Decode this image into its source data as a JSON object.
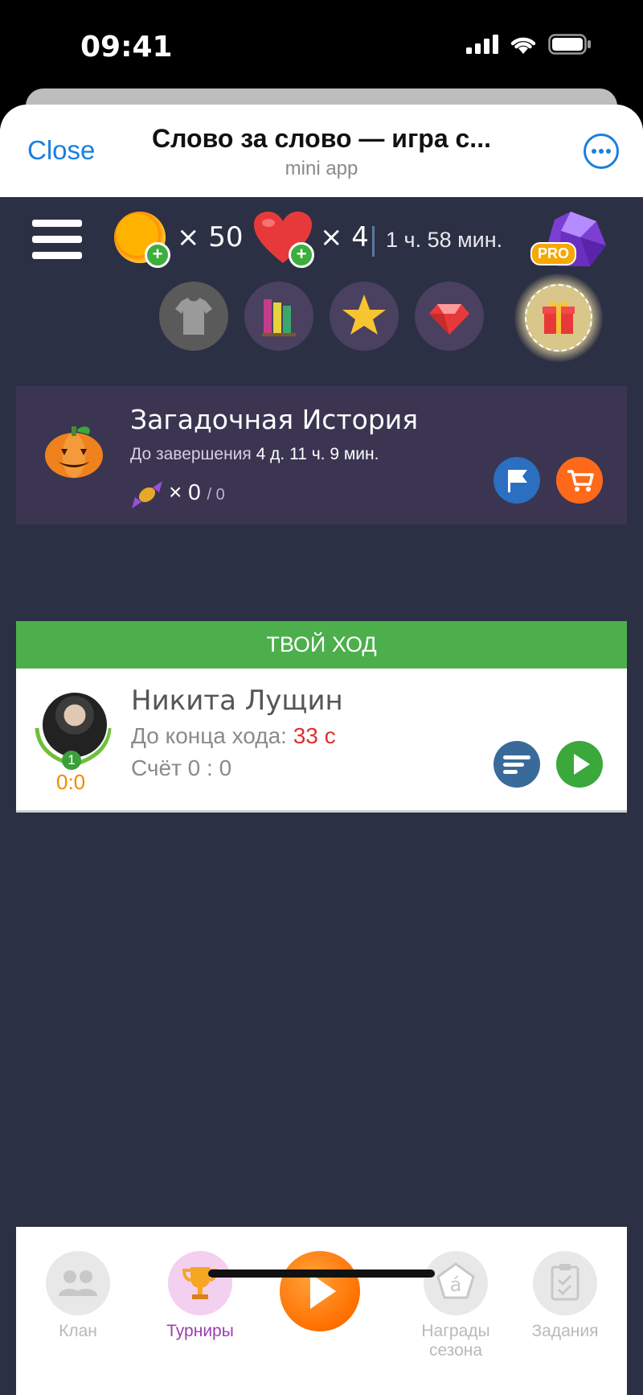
{
  "status_bar": {
    "time": "09:41"
  },
  "telegram": {
    "close_label": "Close",
    "title": "Слово за слово — игра с...",
    "subtitle": "mini app"
  },
  "top_bar": {
    "coins": "× 50",
    "lives": "× 4",
    "lives_timer": "1 ч. 58 мин.",
    "pro_label": "PRO"
  },
  "shop_buttons": [
    "shirt-icon",
    "books-icon",
    "star-icon",
    "gem-icon",
    "gift-icon"
  ],
  "event": {
    "title": "Загадочная История",
    "time_prefix": "До завершения",
    "time_value": "4 д. 11 ч. 9 мин.",
    "candy_count": "× 0",
    "candy_total": "/ 0"
  },
  "turn_banner": "ТВОЙ ХОД",
  "match": {
    "player_name": "Никита Лущин",
    "turn_prefix": "До конца хода:",
    "turn_time": "33 с",
    "score_text": "Счёт 0 : 0",
    "rank": "1",
    "score_small": "0:0"
  },
  "bottom_nav": {
    "clan": "Клан",
    "tournaments": "Турниры",
    "season_rewards_1": "Награды",
    "season_rewards_2": "сезона",
    "tasks": "Задания"
  },
  "colors": {
    "game_bg": "#2c3044",
    "accent_blue": "#1a7fe0",
    "turn_green": "#4caf4c",
    "timer_red": "#e03030",
    "active_nav": "#9a3fb0"
  }
}
